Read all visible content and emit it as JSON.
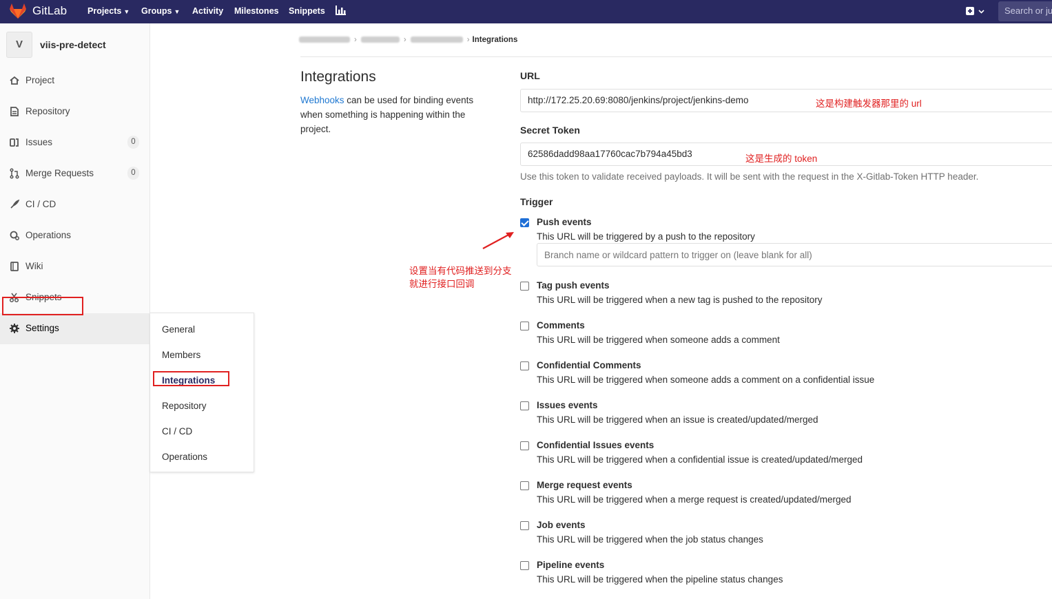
{
  "topnav": {
    "brand": "GitLab",
    "items": [
      "Projects",
      "Groups",
      "Activity",
      "Milestones",
      "Snippets"
    ],
    "search_placeholder": "Search or jump to…"
  },
  "sidebar": {
    "avatar_letter": "V",
    "project_name": "viis-pre-detect",
    "items": [
      {
        "label": "Project",
        "icon": "home-icon"
      },
      {
        "label": "Repository",
        "icon": "doc-icon"
      },
      {
        "label": "Issues",
        "icon": "issues-icon",
        "count": "0"
      },
      {
        "label": "Merge Requests",
        "icon": "merge-icon",
        "count": "0"
      },
      {
        "label": "CI / CD",
        "icon": "rocket-icon"
      },
      {
        "label": "Operations",
        "icon": "cloud-gear-icon"
      },
      {
        "label": "Wiki",
        "icon": "book-icon"
      },
      {
        "label": "Snippets",
        "icon": "scissors-icon"
      },
      {
        "label": "Settings",
        "icon": "gear-icon"
      }
    ]
  },
  "flyout": {
    "items": [
      "General",
      "Members",
      "Integrations",
      "Repository",
      "CI / CD",
      "Operations"
    ],
    "active": "Integrations"
  },
  "breadcrumb": {
    "current": "Integrations"
  },
  "intro": {
    "title": "Integrations",
    "link": "Webhooks",
    "text": " can be used for binding events when something is happening within the project."
  },
  "form": {
    "url_label": "URL",
    "url_value": "http://172.25.20.69:8080/jenkins/project/jenkins-demo",
    "url_note": "这是构建触发器那里的 url",
    "token_label": "Secret Token",
    "token_value": "62586dadd98aa17760cac7b794a45bd3",
    "token_note": "这是生成的 token",
    "token_help": "Use this token to validate received payloads. It will be sent with the request in the X-Gitlab-Token HTTP header.",
    "trigger_label": "Trigger",
    "branch_placeholder": "Branch name or wildcard pattern to trigger on (leave blank for all)",
    "annotation_line1": "设置当有代码推送到分支",
    "annotation_line2": "就进行接口回调",
    "triggers": [
      {
        "title": "Push events",
        "desc": "This URL will be triggered by a push to the repository",
        "checked": true
      },
      {
        "title": "Tag push events",
        "desc": "This URL will be triggered when a new tag is pushed to the repository",
        "checked": false
      },
      {
        "title": "Comments",
        "desc": "This URL will be triggered when someone adds a comment",
        "checked": false
      },
      {
        "title": "Confidential Comments",
        "desc": "This URL will be triggered when someone adds a comment on a confidential issue",
        "checked": false
      },
      {
        "title": "Issues events",
        "desc": "This URL will be triggered when an issue is created/updated/merged",
        "checked": false
      },
      {
        "title": "Confidential Issues events",
        "desc": "This URL will be triggered when a confidential issue is created/updated/merged",
        "checked": false
      },
      {
        "title": "Merge request events",
        "desc": "This URL will be triggered when a merge request is created/updated/merged",
        "checked": false
      },
      {
        "title": "Job events",
        "desc": "This URL will be triggered when the job status changes",
        "checked": false
      },
      {
        "title": "Pipeline events",
        "desc": "This URL will be triggered when the pipeline status changes",
        "checked": false
      }
    ]
  },
  "colors": {
    "nav_bg": "#292961",
    "accent": "#1f78d1",
    "annotation": "#e02020"
  }
}
